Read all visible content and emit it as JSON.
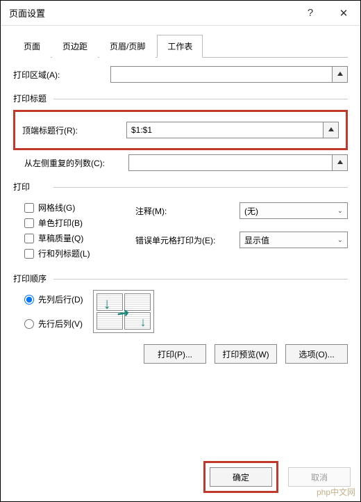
{
  "dialog": {
    "title": "页面设置",
    "help": "?",
    "close": "✕"
  },
  "tabs": {
    "page": "页面",
    "margins": "页边距",
    "headerfooter": "页眉/页脚",
    "sheet": "工作表"
  },
  "print_area": {
    "label": "打印区域(A):",
    "value": ""
  },
  "print_titles": {
    "group": "打印标题",
    "top_rows_label": "顶端标题行(R):",
    "top_rows_value": "$1:$1",
    "left_cols_label": "从左侧重复的列数(C):",
    "left_cols_value": ""
  },
  "print": {
    "group": "打印",
    "gridlines": "网格线(G)",
    "blackwhite": "单色打印(B)",
    "draft": "草稿质量(Q)",
    "rowcolheadings": "行和列标题(L)",
    "comments_label": "注释(M):",
    "comments_value": "(无)",
    "errors_label": "错误单元格打印为(E):",
    "errors_value": "显示值"
  },
  "order": {
    "group": "打印顺序",
    "downover": "先列后行(D)",
    "overthendown": "先行后列(V)"
  },
  "buttons": {
    "print": "打印(P)...",
    "preview": "打印预览(W)",
    "options": "选项(O)...",
    "ok": "确定",
    "cancel": "取消"
  },
  "watermark": "php中文网"
}
